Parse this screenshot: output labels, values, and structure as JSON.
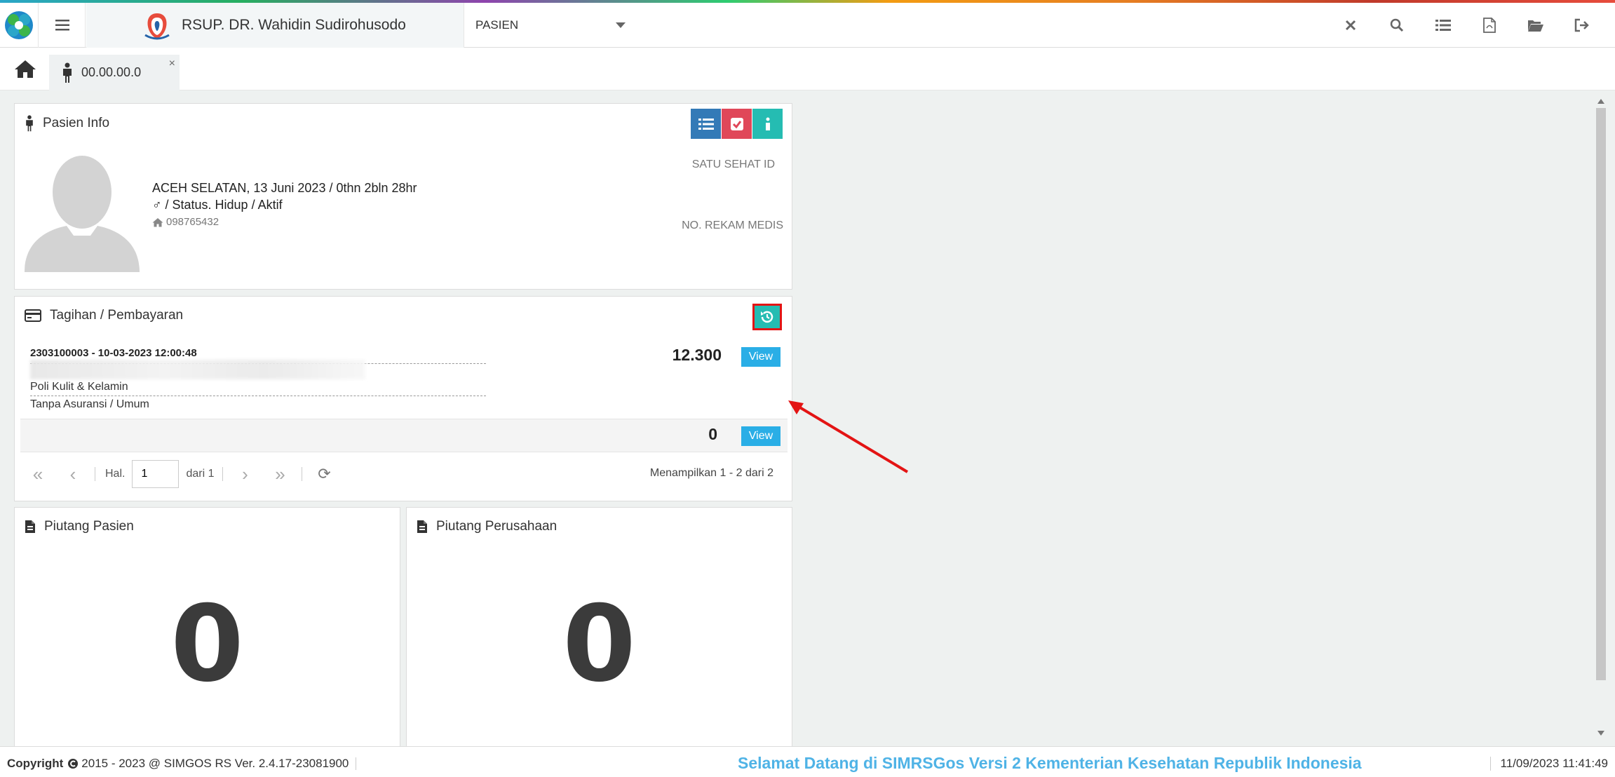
{
  "header": {
    "hospital_name": "RSUP. DR. Wahidin Sudirohusodo",
    "module": "PASIEN",
    "icons": [
      "close-icon",
      "search-icon",
      "list-icon",
      "pdf-icon",
      "folder-open-icon",
      "logout-icon"
    ]
  },
  "tabs": {
    "patient_tab_label": "00.00.00.0",
    "close_symbol": "×"
  },
  "pasien_info": {
    "title": "Pasien Info",
    "birth_line": "ACEH SELATAN, 13 Juni 2023 / 0thn 2bln 28hr",
    "gender_symbol": "♂",
    "status_line": " / Status. Hidup / Aktif",
    "phone": "098765432",
    "satu_sehat_label": "SATU SEHAT ID",
    "rekam_medis_label": "NO. REKAM MEDIS",
    "button_colors": [
      "#337ab7",
      "#e04759",
      "#25bcb2"
    ]
  },
  "tagihan": {
    "title": "Tagihan / Pembayaran",
    "bill_id_datetime": "2303100003 - 10-03-2023 12:00:48",
    "poli": "Poli Kulit & Kelamin",
    "insurance": "Tanpa Asuransi / Umum",
    "amount": "12.300",
    "total": "0",
    "view_label": "View",
    "pager": {
      "hal_label": "Hal.",
      "page": "1",
      "of_label": "dari 1",
      "summary": "Menampilkan 1 - 2 dari 2"
    }
  },
  "piutang_pasien": {
    "title": "Piutang Pasien",
    "value": "0"
  },
  "piutang_perusahaan": {
    "title": "Piutang Perusahaan",
    "value": "0"
  },
  "footer": {
    "copyright_label": "Copyright",
    "copyright_text": "2015 - 2023 @ SIMGOS RS Ver. 2.4.17-23081900",
    "welcome": "Selamat Datang di SIMRSGos Versi 2 Kementerian Kesehatan Republik Indonesia",
    "datetime": "11/09/2023 11:41:49"
  }
}
